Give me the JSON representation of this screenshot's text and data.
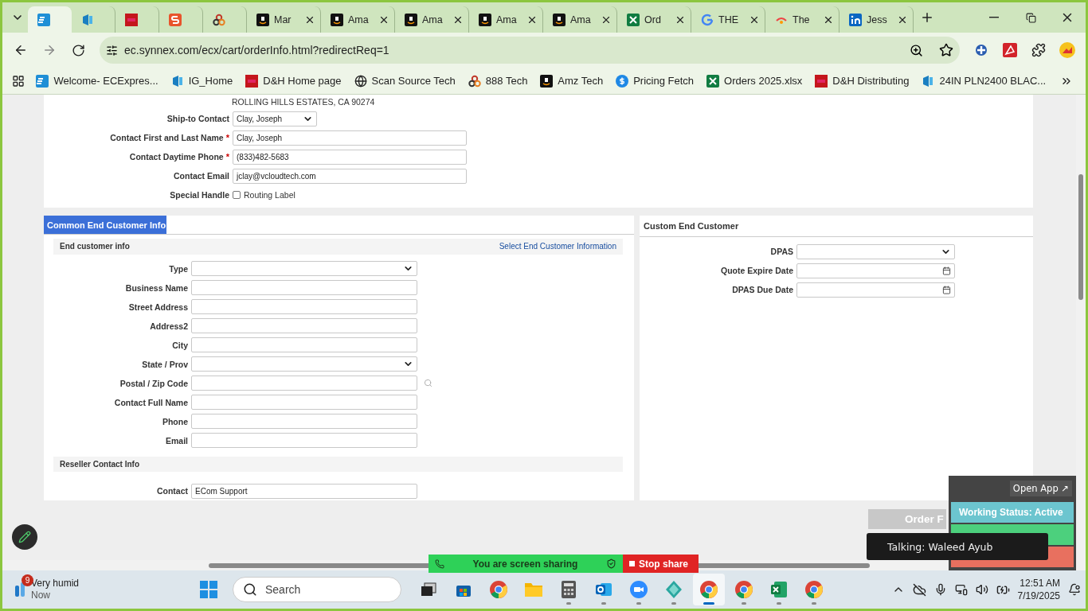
{
  "browser": {
    "tabs": [
      {
        "kind": "ec",
        "selected": true
      },
      {
        "kind": "ig",
        "selected": false
      },
      {
        "kind": "dh",
        "selected": false
      },
      {
        "kind": "s",
        "selected": false
      },
      {
        "kind": "rings",
        "selected": false
      },
      {
        "kind": "amazon",
        "title": "Mar",
        "selected": false
      },
      {
        "kind": "amazon",
        "title": "Ama",
        "selected": false
      },
      {
        "kind": "amazon",
        "title": "Ama",
        "selected": false
      },
      {
        "kind": "amazon",
        "title": "Ama",
        "selected": false
      },
      {
        "kind": "amazon",
        "title": "Ama",
        "selected": false
      },
      {
        "kind": "excel",
        "title": "Ord",
        "selected": false
      },
      {
        "kind": "google",
        "title": "THE",
        "selected": false
      },
      {
        "kind": "tsp",
        "title": "The",
        "selected": false
      },
      {
        "kind": "linkedin",
        "title": "Jess",
        "selected": false
      }
    ],
    "url": "ec.synnex.com/ecx/cart/orderInfo.html?redirectReq=1",
    "bookmarks": [
      {
        "kind": "ec",
        "title": "Welcome- ECExpres..."
      },
      {
        "kind": "ig",
        "title": "IG_Home"
      },
      {
        "kind": "dh",
        "title": "D&H Home page"
      },
      {
        "kind": "globe",
        "title": "Scan Source Tech"
      },
      {
        "kind": "rings",
        "title": "888 Tech"
      },
      {
        "kind": "amazon",
        "title": "Amz Tech"
      },
      {
        "kind": "dollar",
        "title": "Pricing Fetch"
      },
      {
        "kind": "excel",
        "title": "Orders 2025.xlsx"
      },
      {
        "kind": "dh",
        "title": "D&H Distributing"
      },
      {
        "kind": "ig",
        "title": "24IN PLN2400 BLAC..."
      }
    ]
  },
  "ship_to": {
    "address_line": "ROLLING HILLS ESTATES, CA 90274",
    "fields": [
      {
        "label": "Ship-to Contact",
        "kind": "select",
        "value": "Clay, Joseph"
      },
      {
        "label": "Contact First and Last Name",
        "mark": "*",
        "kind": "text",
        "value": "Clay, Joseph"
      },
      {
        "label": "Contact Daytime Phone",
        "mark": "*",
        "kind": "text",
        "value": "(833)482-5683"
      },
      {
        "label": "Contact Email",
        "kind": "text",
        "value": "jclay@vcloudtech.com"
      },
      {
        "label": "Special Handle",
        "kind": "checkbox",
        "option": "Routing Label",
        "checked": false
      }
    ]
  },
  "end_customer": {
    "title": "Common End Customer Info",
    "section": "End customer info",
    "link": "Select End Customer Information",
    "fields": [
      {
        "label": "Type",
        "kind": "select"
      },
      {
        "label": "Business Name",
        "kind": "text"
      },
      {
        "label": "Street Address",
        "kind": "text"
      },
      {
        "label": "Address2",
        "kind": "text"
      },
      {
        "label": "City",
        "kind": "text"
      },
      {
        "label": "State / Prov",
        "kind": "select"
      },
      {
        "label": "Postal / Zip Code",
        "kind": "lookup"
      },
      {
        "label": "Contact Full Name",
        "kind": "text"
      },
      {
        "label": "Phone",
        "kind": "text"
      },
      {
        "label": "Email",
        "kind": "text"
      }
    ],
    "reseller_section": "Reseller Contact Info",
    "reseller_fields": [
      {
        "label": "Contact",
        "kind": "text",
        "value": "ECom Support"
      }
    ]
  },
  "custom_end_customer": {
    "title": "Custom End Customer",
    "fields": [
      {
        "label": "DPAS",
        "kind": "select"
      },
      {
        "label": "Quote Expire Date",
        "kind": "date"
      },
      {
        "label": "DPAS Due Date",
        "kind": "date"
      }
    ]
  },
  "order_button": "Order F",
  "status_widget": {
    "open_app": "Open App ↗",
    "status": "Working Status: Active"
  },
  "tooltip": "Talking: Waleed Ayub",
  "screen_share": {
    "message": "You are screen sharing",
    "stop": "Stop share"
  },
  "taskbar": {
    "weather": {
      "badge": "9",
      "title": "Very humid",
      "subtitle": "Now"
    },
    "search_placeholder": "Search",
    "apps": [
      {
        "kind": "taskview",
        "running": false,
        "selected": false
      },
      {
        "kind": "store",
        "running": false,
        "selected": false
      },
      {
        "kind": "chrome",
        "running": false,
        "selected": false
      },
      {
        "kind": "folder",
        "running": false,
        "selected": false
      },
      {
        "kind": "calculator",
        "running": true,
        "selected": false
      },
      {
        "kind": "outlook",
        "running": true,
        "selected": false
      },
      {
        "kind": "zoom",
        "running": true,
        "selected": false
      },
      {
        "kind": "diamond",
        "running": true,
        "selected": false
      },
      {
        "kind": "chrome",
        "running": true,
        "selected": true
      },
      {
        "kind": "chrome",
        "running": true,
        "selected": false
      },
      {
        "kind": "excel",
        "running": true,
        "selected": false
      },
      {
        "kind": "chrome",
        "running": true,
        "selected": false
      }
    ],
    "time": "12:51 AM",
    "date": "7/19/2025"
  }
}
